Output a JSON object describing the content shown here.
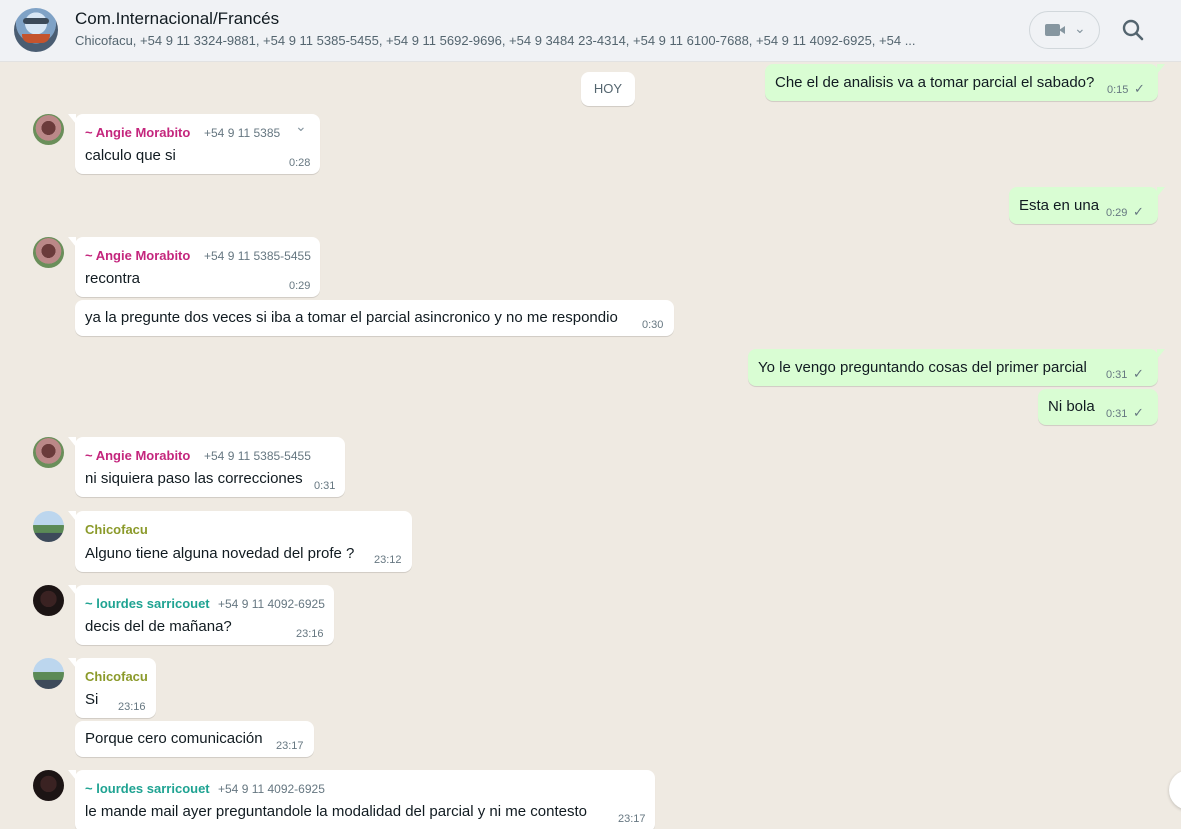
{
  "header": {
    "title": "Com.Internacional/Francés",
    "subtitle": "Chicofacu, +54 9 11 3324-9881, +54 9 11 5385-5455, +54 9 11 5692-9696, +54 9 3484 23-4314, +54 9 11 6100-7688, +54 9 11 4092-6925, +54 ...",
    "video_icon": "video-camera-icon",
    "search_icon": "search-icon"
  },
  "day_separator": "HOY",
  "messages": [
    {
      "dir": "out",
      "text": "Che el de analisis va a tomar parcial el sabado?",
      "time": "0:15"
    },
    {
      "dir": "in",
      "sender": "~ Angie Morabito",
      "phone": "+54 9 11 5385",
      "text": "calculo que si",
      "time": "0:28"
    },
    {
      "dir": "out",
      "text": "Esta en una",
      "time": "0:29"
    },
    {
      "dir": "in",
      "sender": "~ Angie Morabito",
      "phone": "+54 9 11 5385-5455",
      "text": "recontra",
      "time": "0:29"
    },
    {
      "dir": "in",
      "text": "ya la pregunte dos veces si iba a tomar el parcial asincronico y no me respondio",
      "time": "0:30"
    },
    {
      "dir": "out",
      "text": "Yo le vengo preguntando cosas del primer parcial",
      "time": "0:31"
    },
    {
      "dir": "out",
      "text": "Ni bola",
      "time": "0:31"
    },
    {
      "dir": "in",
      "sender": "~ Angie Morabito",
      "phone": "+54 9 11 5385-5455",
      "text": "ni siquiera paso las correcciones",
      "time": "0:31"
    },
    {
      "dir": "in",
      "sender": "Chicofacu",
      "text": "Alguno tiene alguna novedad del profe ?",
      "time": "23:12"
    },
    {
      "dir": "in",
      "sender": "~ lourdes sarricouet",
      "phone": "+54 9 11 4092-6925",
      "text": "decis del de mañana?",
      "time": "23:16"
    },
    {
      "dir": "in",
      "sender": "Chicofacu",
      "text": "Si",
      "time": "23:16"
    },
    {
      "dir": "in",
      "text": "Porque cero comunicación",
      "time": "23:17"
    },
    {
      "dir": "in",
      "sender": "~ lourdes sarricouet",
      "phone": "+54 9 11 4092-6925",
      "text": "le mande mail ayer preguntandole la modalidad del parcial y ni me contesto",
      "time": "23:17"
    }
  ],
  "colors": {
    "angie": "#c4267d",
    "chicofacu": "#8b9a2a",
    "lourdes": "#1fa392",
    "outgoing_bg": "#d9fdd3",
    "chat_bg": "#efeae2"
  },
  "check_glyph": "✓",
  "dropdown_glyph": "⌄"
}
